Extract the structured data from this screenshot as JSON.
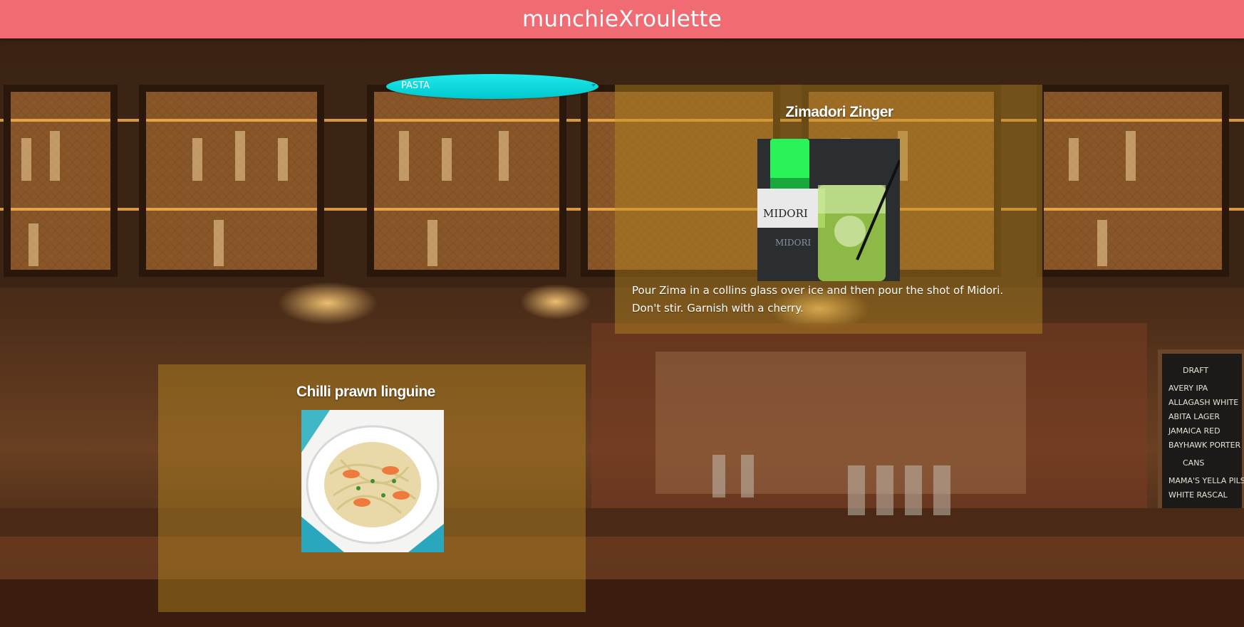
{
  "header": {
    "title": "munchieXroulette"
  },
  "filter": {
    "selected": "PASTA"
  },
  "drink": {
    "name": "Zimadori Zinger",
    "instructions": "Pour Zima in a collins glass over ice and then pour the shot of Midori. Don't stir. Garnish with a cherry.",
    "photo_label": "MIDORI",
    "photo_label_2": "MIDORI"
  },
  "food": {
    "name": "Chilli prawn linguine"
  },
  "colors": {
    "header": "#f06b72",
    "dropdown": "#1ee9ea",
    "card": "#b88a22"
  }
}
